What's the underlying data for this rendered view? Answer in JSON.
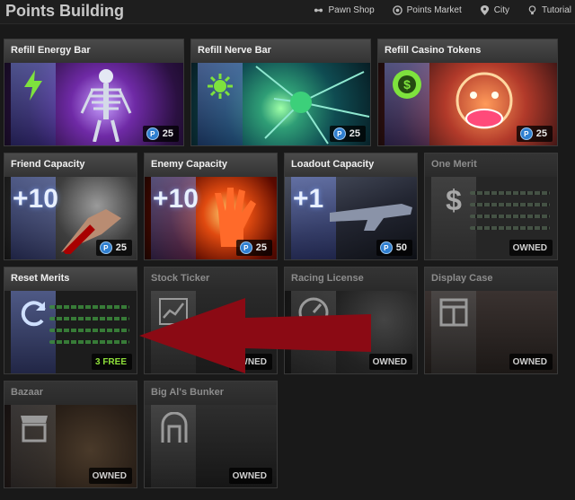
{
  "page": {
    "title": "Points Building"
  },
  "nav": [
    {
      "label": "Pawn Shop",
      "icon": "pawn-icon"
    },
    {
      "label": "Points Market",
      "icon": "points-market-icon"
    },
    {
      "label": "City",
      "icon": "map-pin-icon"
    },
    {
      "label": "Tutorial",
      "icon": "lightbulb-icon"
    }
  ],
  "coin_symbol": "P",
  "cards": {
    "refill_energy": {
      "title": "Refill Energy Bar",
      "cost": "25"
    },
    "refill_nerve": {
      "title": "Refill Nerve Bar",
      "cost": "25"
    },
    "refill_casino": {
      "title": "Refill Casino Tokens",
      "cost": "25"
    },
    "friend_capacity": {
      "title": "Friend Capacity",
      "bonus": "+10",
      "cost": "25"
    },
    "enemy_capacity": {
      "title": "Enemy Capacity",
      "bonus": "+10",
      "cost": "25"
    },
    "loadout_capacity": {
      "title": "Loadout Capacity",
      "bonus": "+1",
      "cost": "50"
    },
    "one_merit": {
      "title": "One Merit",
      "status": "OWNED"
    },
    "reset_merits": {
      "title": "Reset Merits",
      "status": "3 FREE"
    },
    "stock_ticker": {
      "title": "Stock Ticker",
      "status": "OWNED"
    },
    "racing_license": {
      "title": "Racing License",
      "status": "OWNED"
    },
    "display_case": {
      "title": "Display Case",
      "status": "OWNED"
    },
    "bazaar": {
      "title": "Bazaar",
      "status": "OWNED"
    },
    "big_als_bunker": {
      "title": "Big Al's Bunker",
      "status": "OWNED"
    }
  },
  "colors": {
    "accent_blue": "#2f7fd0",
    "free_green": "#8fe03a",
    "arrow_red": "#8b0a14"
  }
}
